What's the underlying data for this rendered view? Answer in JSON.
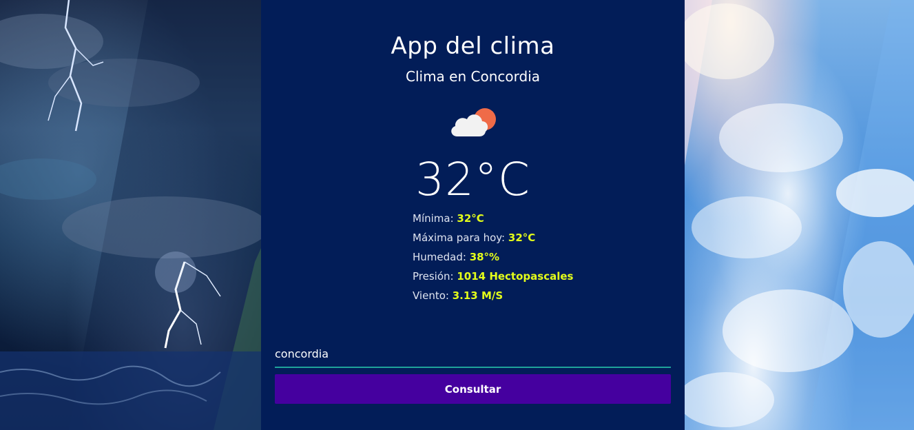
{
  "app": {
    "title": "App del clima",
    "subtitle": "Clima en Concordia"
  },
  "weather": {
    "icon": "partly-cloudy-icon",
    "temperature": "32°C",
    "details": [
      {
        "label": "Mínima: ",
        "value": "32°C"
      },
      {
        "label": "Máxima para hoy: ",
        "value": "32°C"
      },
      {
        "label": "Humedad: ",
        "value": "38°%"
      },
      {
        "label": "Presión: ",
        "value": "1014 Hectopascales"
      },
      {
        "label": "Viento: ",
        "value": "3.13 M/S"
      }
    ]
  },
  "search": {
    "value": "concordia",
    "button_label": "Consultar"
  },
  "colors": {
    "panel_background": "#021d58",
    "accent_value": "#e4ff1a",
    "button": "#45009f",
    "input_underline": "#1fa39a"
  }
}
